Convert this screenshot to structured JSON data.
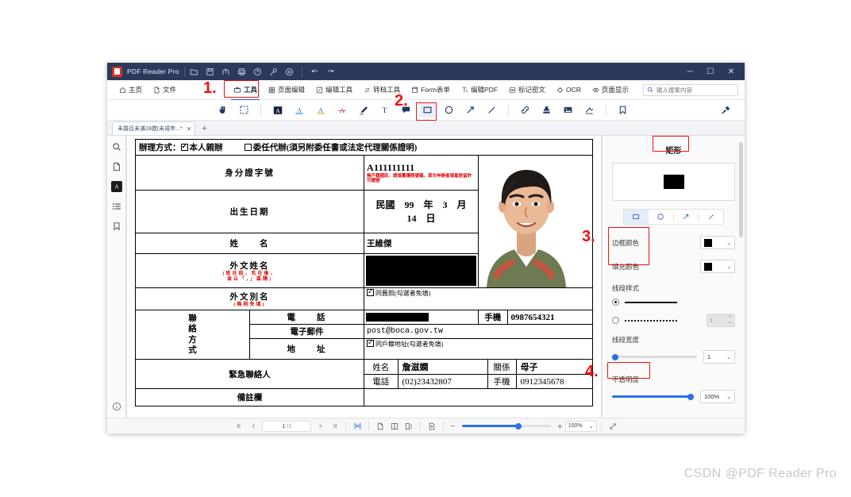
{
  "window": {
    "app_title": "PDF Reader Pro",
    "logo_icon": "pdf-logo-icon",
    "titlebar_icons": [
      "open-folder-icon",
      "save-icon",
      "share-icon",
      "print-icon",
      "help-icon",
      "key-icon",
      "settings-icon",
      "undo-icon",
      "redo-icon"
    ],
    "controls": {
      "minimize": "─",
      "maximize": "☐",
      "close": "✕"
    }
  },
  "menubar": {
    "items": [
      {
        "label": "主页",
        "icon": "home-icon",
        "active": false
      },
      {
        "label": "文件",
        "icon": "file-icon",
        "active": false
      },
      {
        "label": "工具",
        "icon": "toolbox-icon",
        "active": true
      },
      {
        "label": "页面编辑",
        "icon": "page-edit-icon",
        "active": false
      },
      {
        "label": "编辑工具",
        "icon": "edit-tool-icon",
        "active": false
      },
      {
        "label": "转档工具",
        "icon": "convert-icon",
        "active": false
      },
      {
        "label": "Form表单",
        "icon": "form-icon",
        "active": false
      },
      {
        "label": "编辑PDF",
        "icon": "edit-pdf-icon",
        "active": false
      },
      {
        "label": "标记密文",
        "icon": "redact-icon",
        "active": false
      },
      {
        "label": "OCR",
        "icon": "ocr-icon",
        "active": false
      },
      {
        "label": "页面显示",
        "icon": "eye-icon",
        "active": false
      }
    ]
  },
  "search": {
    "placeholder": "输入搜索内容",
    "value": "",
    "icon": "search-icon"
  },
  "annotation_toolbar": {
    "tools": [
      {
        "name": "hand-tool-icon",
        "selected": false
      },
      {
        "name": "select-area-icon",
        "selected": false
      },
      {
        "name": "highlight-block-icon",
        "selected": false
      },
      {
        "name": "underline-text-icon",
        "selected": false
      },
      {
        "name": "squiggly-text-icon",
        "selected": false
      },
      {
        "name": "strikethrough-text-icon",
        "selected": false
      },
      {
        "name": "marker-pen-icon",
        "selected": false
      },
      {
        "name": "text-box-icon",
        "selected": false
      },
      {
        "name": "sticky-note-icon",
        "selected": false
      },
      {
        "name": "rectangle-icon",
        "selected": true
      },
      {
        "name": "circle-icon",
        "selected": false
      },
      {
        "name": "arrow-icon",
        "selected": false
      },
      {
        "name": "line-icon",
        "selected": false
      },
      {
        "name": "link-icon",
        "selected": false
      },
      {
        "name": "stamp-icon",
        "selected": false
      },
      {
        "name": "image-icon",
        "selected": false
      },
      {
        "name": "signature-icon",
        "selected": false
      },
      {
        "name": "bookmark-icon",
        "selected": false
      },
      {
        "name": "pin-icon",
        "selected": false
      }
    ]
  },
  "tabstrip": {
    "tab_title": "未婚且未滿18歲(未成年...*",
    "close_label": "✕",
    "new_tab_label": "+"
  },
  "leftrail": {
    "items": [
      {
        "name": "search-panel-icon",
        "active": false
      },
      {
        "name": "thumbnails-panel-icon",
        "active": false
      },
      {
        "name": "annotations-panel-icon",
        "active": true
      },
      {
        "name": "outline-panel-icon",
        "active": false
      },
      {
        "name": "bookmarks-panel-icon",
        "active": false
      }
    ],
    "bottom": {
      "name": "info-icon"
    }
  },
  "document": {
    "header_row": {
      "prefix": "辦理方式：",
      "option1": {
        "label": "本人親辦",
        "checked": true
      },
      "option2": {
        "label": "委任代辦(須另附委任書或法定代理關係證明)",
        "checked": false
      }
    },
    "rows": [
      {
        "label": "身分證字號",
        "value": "A111111111",
        "note": "無戶籍國民：請填舊護照號碼，首次申辦者填寫居留許可證號"
      },
      {
        "label": "出生日期",
        "value": "民國　99　年　3　月　14　日"
      },
      {
        "label": "姓　　名",
        "value": "王維傑"
      },
      {
        "label": "外文姓名",
        "sublabel": "(姓在前，名在後，\n並以「，」區隔)",
        "redacted": true
      },
      {
        "label": "外文別名",
        "sublabel": "(無則免填)",
        "checkbox": {
          "label": "同舊照(勾選者免填)",
          "checked": true
        }
      }
    ],
    "contact_group_label": "聯絡方式",
    "contact": [
      {
        "label": "電　　話",
        "redacted": true,
        "label2": "手機",
        "value2": "0987654321"
      },
      {
        "label": "電子郵件",
        "value": "post@boca.gov.tw"
      },
      {
        "label": "地　　址",
        "checkbox": {
          "label": "同戶籍地址(勾選者免填)",
          "checked": true
        }
      }
    ],
    "emergency_label": "緊急聯絡人",
    "emergency": [
      {
        "k1": "姓名",
        "v1": "詹滋嫻",
        "k2": "關係",
        "v2": "母子"
      },
      {
        "k1": "電話",
        "v1": "(02)23432807",
        "k2": "手機",
        "v2": "0912345678"
      }
    ],
    "remarks_label": "備註欄",
    "photo_alt": "applicant-photo"
  },
  "properties_panel": {
    "title": "矩形",
    "preview_color": "#000000",
    "shape_tabs": [
      {
        "name": "rectangle-shape-icon",
        "selected": true
      },
      {
        "name": "circle-shape-icon",
        "selected": false
      },
      {
        "name": "arrow-shape-icon",
        "selected": false
      },
      {
        "name": "line-shape-icon",
        "selected": false
      }
    ],
    "border_color": {
      "label": "边框颜色",
      "value": "#000000"
    },
    "fill_color": {
      "label": "填充颜色",
      "value": "#000000"
    },
    "line_style": {
      "label": "线段样式",
      "solid_selected": true,
      "dashed_selected": false,
      "dash_value": "1"
    },
    "line_width": {
      "label": "线段宽度",
      "value": "1",
      "percent": 2
    },
    "opacity": {
      "label": "不透明度",
      "value": "100%",
      "percent": 100
    }
  },
  "statusbar": {
    "first_page_icon": "first-page-icon",
    "prev_page_icon": "prev-page-icon",
    "current_page": "1",
    "total_pages": "/1",
    "next_page_icon": "next-page-icon",
    "last_page_icon": "last-page-icon",
    "fit_icon": "fit-width-icon",
    "single_page_icon": "single-page-icon",
    "double_page_icon": "double-page-icon",
    "continuous_icon": "continuous-scroll-icon",
    "crop_icon": "crop-page-icon",
    "zoom_out": "−",
    "zoom_in": "+",
    "zoom_value": "100%",
    "fullscreen_icon": "fullscreen-icon"
  },
  "callouts": [
    {
      "number": "1.",
      "target": "工具 menu item"
    },
    {
      "number": "2.",
      "target": "rectangle annotation tool"
    },
    {
      "number": "3.",
      "target": "border and fill color labels"
    },
    {
      "number": "4.",
      "target": "opacity label"
    }
  ],
  "watermark": {
    "text": "CSDN @PDF Reader Pro"
  },
  "colors": {
    "titlebar": "#2b3a5c",
    "accent_blue": "#2b72e8",
    "callout_red": "#ee1111",
    "menu_active": "#1a2e55"
  }
}
